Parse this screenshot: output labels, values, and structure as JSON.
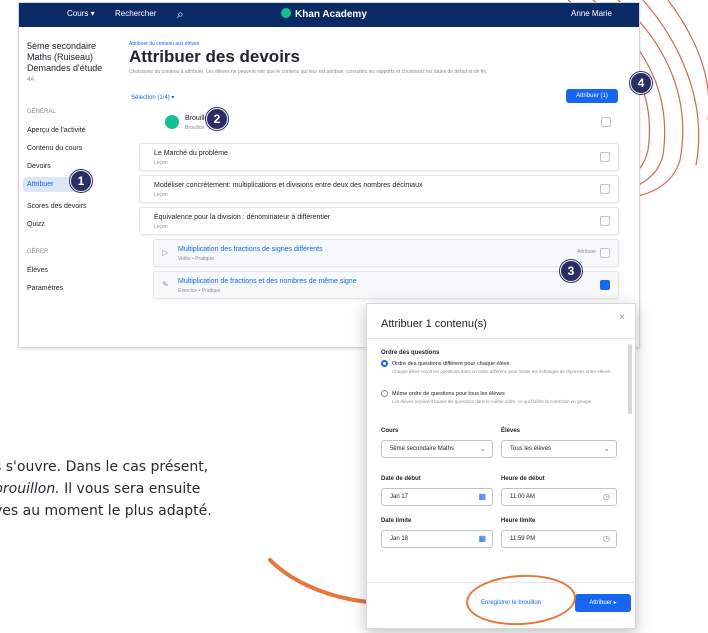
{
  "topbar": {
    "courses": "Cours ▾",
    "search_label": "Rechercher",
    "brand": "Khan Academy",
    "user": "Anne Marie"
  },
  "sidebar": {
    "class_name": "5ème secondaire Maths (Ruiseau) Demandes d'étude",
    "class_sub": "4A",
    "section_general": "GÉNÉRAL",
    "items": [
      {
        "label": "Aperçu de l'activité"
      },
      {
        "label": "Contenu du cours"
      },
      {
        "label": "Devoirs"
      },
      {
        "label": "Attribuer"
      },
      {
        "label": "Scores des devoirs"
      },
      {
        "label": "Quizz"
      }
    ],
    "section_admin": "GÉRER",
    "admin_items": [
      {
        "label": "Élèves"
      },
      {
        "label": "Paramètres"
      }
    ]
  },
  "main": {
    "breadcrumb": "Attribuer du contenu aux élèves",
    "title": "Attribuer des devoirs",
    "subtitle": "Choisissez du contenu à attribuer. Les élèves ne peuvent voir que le contenu qui leur est attribué, consultez les rapports et choisissez les dates de début et de fin.",
    "selected_count": "Sélection (1/4) ▾",
    "assign_button": "Attribuer (1)",
    "course_header": {
      "name": "Brouillon",
      "sub": "Brouillon"
    },
    "rows": [
      {
        "name": "Le Marché du problème",
        "sub": "Leçon",
        "type": "course"
      },
      {
        "name": "Modéliser concrètement: multiplications et divisions entre deux des nombres décimaux",
        "sub": "Leçon",
        "type": "course"
      },
      {
        "name": "Équivalence pour la division : dénominateur à différentier",
        "sub": "Leçon",
        "type": "course"
      },
      {
        "name": "Multiplication des fractions de signes différents",
        "sub": "Vidéo • Pratique",
        "type": "content",
        "tag": "Attribuer",
        "checked": false
      },
      {
        "name": "Multiplication de fractions et des nombres de même signe",
        "sub": "Exercice • Pratique",
        "type": "content",
        "tag": "",
        "checked": true
      }
    ]
  },
  "markers": [
    "1",
    "2",
    "3",
    "4"
  ],
  "body_text": {
    "line1": "s s'ouvre. Dans le cas présent,",
    "line2a": "",
    "line2_em": "brouillon.",
    "line2b": " Il vous sera ensuite",
    "line3": "ves au moment le plus adapté."
  },
  "dialog": {
    "title": "Attribuer 1 contenu(s)",
    "close": "×",
    "ordre_label": "Ordre des questions",
    "options": [
      {
        "label": "Ordre des questions différent pour chaque élève",
        "desc": "Chaque élève reçoit les questions dans un ordre différent, pour limiter les échanges de réponses entre élèves.",
        "selected": true
      },
      {
        "label": "Même ordre de questions pour tous les élèves",
        "desc": "Les élèves reçoivent toutes les questions dans le même ordre, ce qui facilite la correction en groupe.",
        "selected": false
      }
    ],
    "cours_label": "Cours",
    "cours_value": "5ème secondaire Maths",
    "eleves_label": "Élèves",
    "eleves_value": "Tous les élèves",
    "date_debut_label": "Date de début",
    "date_debut_value": "Jan 17",
    "heure_debut_label": "Heure de début",
    "heure_debut_value": "11:00 AM",
    "date_fin_label": "Date limite",
    "date_fin_value": "Jan 18",
    "heure_fin_label": "Heure limite",
    "heure_fin_value": "11:59 PM",
    "save_draft": "Enregistrer le brouillon",
    "assign": "Attribuer ▸"
  },
  "colors": {
    "topbar": "#0a2a66",
    "accent": "#1865f2",
    "marker": "#2b2d66",
    "annotation": "#e8763a"
  }
}
